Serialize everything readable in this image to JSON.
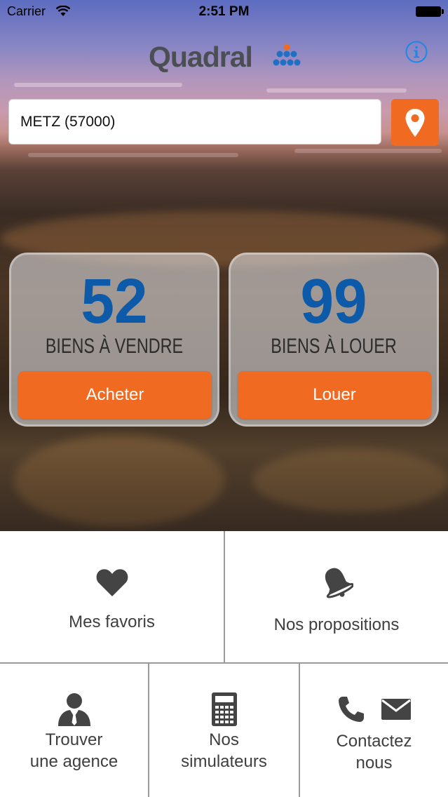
{
  "status_bar": {
    "carrier": "Carrier",
    "time": "2:51 PM"
  },
  "header": {
    "logo_text": "Quadral",
    "info_icon": "info-icon"
  },
  "search": {
    "value": "METZ (57000)",
    "location_icon": "location-pin-icon"
  },
  "cards": {
    "sale": {
      "count": "52",
      "label": "BIENS À VENDRE",
      "button": "Acheter"
    },
    "rent": {
      "count": "99",
      "label": "BIENS À LOUER",
      "button": "Louer"
    }
  },
  "menu": {
    "favorites": {
      "label": "Mes favoris",
      "icon": "heart-icon"
    },
    "propositions": {
      "label": "Nos propositions",
      "icon": "bell-icon"
    },
    "agency": {
      "line1": "Trouver",
      "line2": "une agence",
      "icon": "person-icon"
    },
    "simulators": {
      "line1": "Nos",
      "line2": "simulateurs",
      "icon": "calculator-icon"
    },
    "contact": {
      "line1": "Contactez",
      "line2": "nous",
      "icon_phone": "phone-icon",
      "icon_mail": "mail-icon"
    }
  },
  "colors": {
    "accent": "#f16a22",
    "count_blue": "#0d5aa8",
    "logo_gray": "#4b4f54",
    "info_blue": "#1e88e5"
  }
}
